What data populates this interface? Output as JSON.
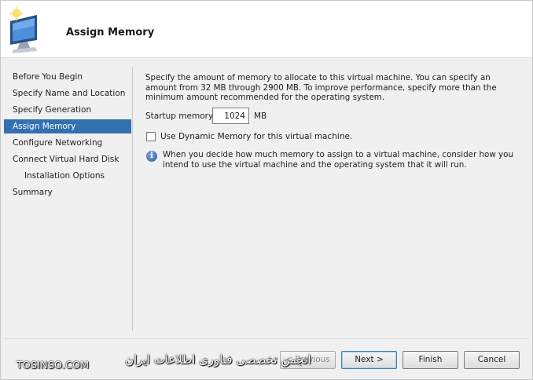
{
  "header": {
    "title": "Assign Memory",
    "icon": "virtual-machine-wizard-icon"
  },
  "sidebar": {
    "items": [
      {
        "label": "Before You Begin",
        "active": false,
        "sub": false
      },
      {
        "label": "Specify Name and Location",
        "active": false,
        "sub": false
      },
      {
        "label": "Specify Generation",
        "active": false,
        "sub": false
      },
      {
        "label": "Assign Memory",
        "active": true,
        "sub": false
      },
      {
        "label": "Configure Networking",
        "active": false,
        "sub": false
      },
      {
        "label": "Connect Virtual Hard Disk",
        "active": false,
        "sub": false
      },
      {
        "label": "Installation Options",
        "active": false,
        "sub": true
      },
      {
        "label": "Summary",
        "active": false,
        "sub": false
      }
    ]
  },
  "main": {
    "description": "Specify the amount of memory to allocate to this virtual machine. You can specify an amount from 32 MB through 2900 MB. To improve performance, specify more than the minimum amount recommended for the operating system.",
    "startup_memory": {
      "label": "Startup memory:",
      "value": "1024",
      "unit": "MB"
    },
    "dynamic_memory": {
      "label": "Use Dynamic Memory for this virtual machine.",
      "checked": false
    },
    "info": {
      "icon": "info-icon",
      "text": "When you decide how much memory to assign to a virtual machine, consider how you intend to use the virtual machine and the operating system that it will run."
    }
  },
  "footer": {
    "previous_label": "< Previous",
    "next_label": "Next >",
    "finish_label": "Finish",
    "cancel_label": "Cancel"
  },
  "watermark": {
    "brand": "TOSINSO.COM",
    "farsi": "انجمن تخصصی فناوری اطلاعات ایران"
  },
  "colors": {
    "active_nav": "#3270b0",
    "header_bg": "#ffffff",
    "window_bg": "#f0f0f0"
  }
}
